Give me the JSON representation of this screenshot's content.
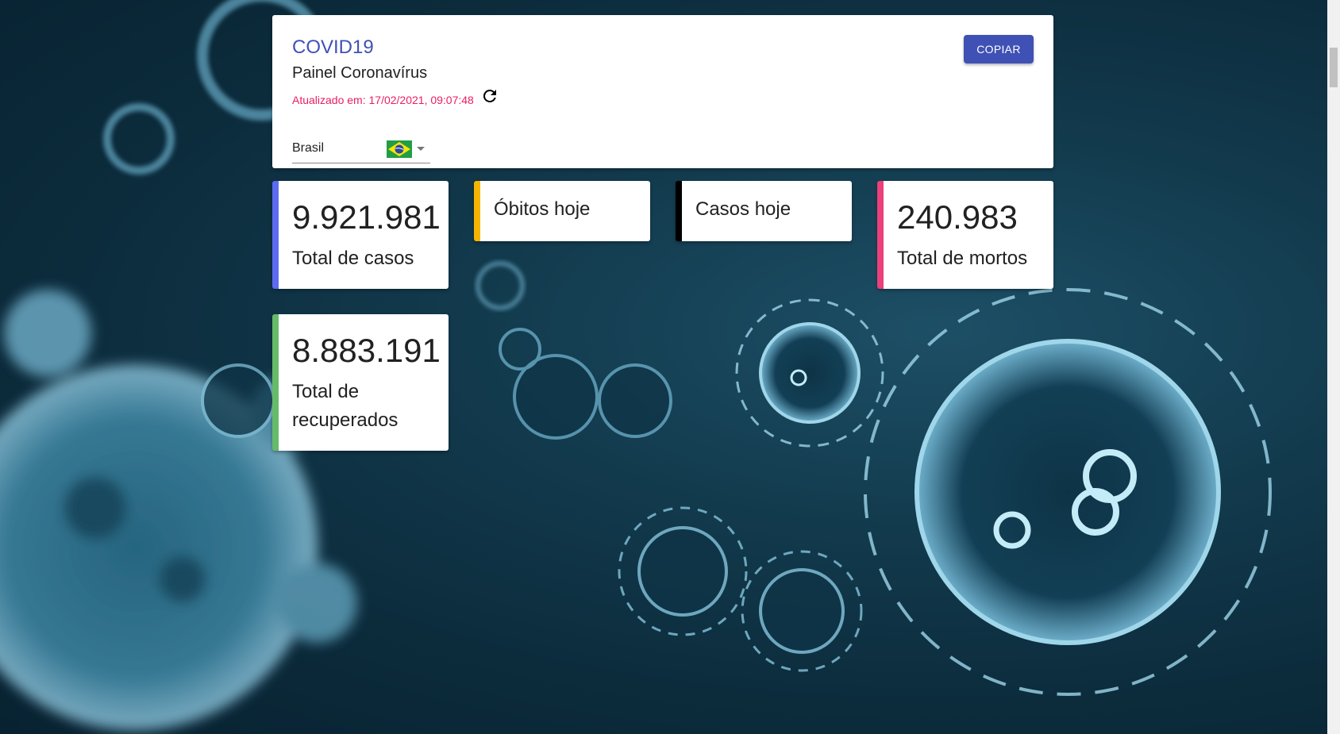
{
  "header": {
    "title": "COVID19",
    "subtitle": "Painel Coronavírus",
    "updated": "Atualizado em: 17/02/2021, 09:07:48",
    "refresh_icon": "refresh-icon",
    "country": {
      "selected": "Brasil",
      "flag_icon": "brazil-flag-icon",
      "dropdown_icon": "chevron-down-icon"
    },
    "copy_label": "COPIAR"
  },
  "stats": {
    "total_cases": {
      "value": "9.921.981",
      "label": "Total de casos"
    },
    "deaths_today": {
      "value": "",
      "label": "Óbitos hoje"
    },
    "cases_today": {
      "value": "",
      "label": "Casos hoje"
    },
    "total_deaths": {
      "value": "240.983",
      "label": "Total de mortos"
    },
    "total_recovered": {
      "value": "8.883.191",
      "label": "Total de recuperados"
    }
  },
  "colors": {
    "primary": "#3f51b5",
    "accent": "#e91e63",
    "total_cases_border": "#5c6bf0",
    "deaths_today_border": "#f4b400",
    "cases_today_border": "#000000",
    "total_deaths_border": "#ec407a",
    "recovered_border": "#66bb6a"
  }
}
